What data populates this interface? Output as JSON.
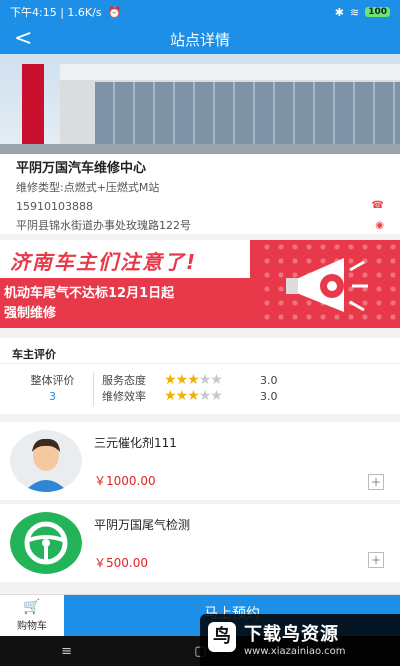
{
  "status_bar": {
    "time_speed": "下午4:15 | 1.6K/s",
    "battery": "100"
  },
  "nav": {
    "back": "<",
    "title": "站点详情"
  },
  "station": {
    "name": "平阴万国汽车维修中心",
    "types": "维修类型:点燃式+压燃式M站",
    "phone": "15910103888",
    "address": "平阴县锦水街道办事处玫瑰路122号"
  },
  "banner": {
    "headline": "济南车主们注意了!",
    "line1": "机动车尾气不达标12月1日起",
    "line2": "强制维修"
  },
  "rating": {
    "header": "车主评价",
    "overall_label": "整体评价",
    "overall_value": "3",
    "rows": [
      {
        "label": "服务态度",
        "stars": 3,
        "score": "3.0"
      },
      {
        "label": "维修效率",
        "stars": 3,
        "score": "3.0"
      }
    ]
  },
  "products": [
    {
      "name": "三元催化剂111",
      "price": "￥1000.00",
      "icon": "avatar-person-icon"
    },
    {
      "name": "平阴万国尾气检测",
      "price": "￥500.00",
      "icon": "steering-wheel-icon"
    }
  ],
  "bottom": {
    "cart_label": "购物车",
    "reserve_label": "马上预约"
  },
  "watermark": {
    "title": "下载鸟资源",
    "url": "www.xiazainiao.com"
  },
  "colors": {
    "primary": "#1e8fe6",
    "price": "#e02424",
    "banner": "#e8394a",
    "star": "#f0b200"
  }
}
